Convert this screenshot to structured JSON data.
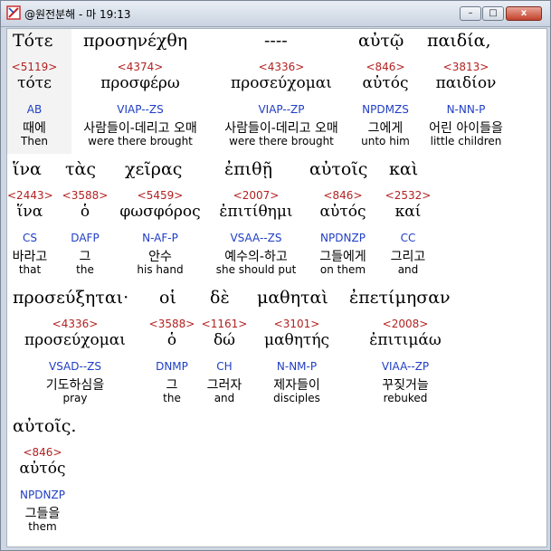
{
  "window": {
    "title": "@원전분해 - 마 19:13",
    "buttons": {
      "minimize": "–",
      "maximize": "□",
      "close": "x"
    }
  },
  "rows": [
    {
      "words": [
        {
          "greek": "Τότε",
          "strong": "<5119>",
          "lemma": "τότε",
          "parse": "AB",
          "kor": "때에",
          "eng": "Then"
        },
        {
          "greek": "προσηνέχθη",
          "strong": "<4374>",
          "lemma": "προσφέρω",
          "parse": "VIAP--ZS",
          "kor": "사람들이-데리고 오매",
          "eng": "were there brought"
        },
        {
          "greek": "----",
          "strong": "<4336>",
          "lemma": "προσεύχομαι",
          "parse": "VIAP--ZP",
          "kor": "사람들이-데리고 오매",
          "eng": "were there brought"
        },
        {
          "greek": "αὐτῷ",
          "strong": "<846>",
          "lemma": "αὐτός",
          "parse": "NPDMZS",
          "kor": "그에게",
          "eng": "unto him"
        },
        {
          "greek": "παιδία,",
          "strong": "<3813>",
          "lemma": "παιδίον",
          "parse": "N-NN-P",
          "kor": "어린 아이들을",
          "eng": "little children"
        }
      ]
    },
    {
      "words": [
        {
          "greek": "ἵνα",
          "strong": "<2443>",
          "lemma": "ἵνα",
          "parse": "CS",
          "kor": "바라고",
          "eng": "that"
        },
        {
          "greek": "τὰς",
          "strong": "<3588>",
          "lemma": "ὁ",
          "parse": "DAFP",
          "kor": "그",
          "eng": "the"
        },
        {
          "greek": "χεῖρας",
          "strong": "<5459>",
          "lemma": "φωσφόρος",
          "parse": "N-AF-P",
          "kor": "안수",
          "eng": "his hand"
        },
        {
          "greek": "ἐπιθῇ",
          "strong": "<2007>",
          "lemma": "ἐπιτίθημι",
          "parse": "VSAA--ZS",
          "kor": "예수의-하고",
          "eng": "she should put"
        },
        {
          "greek": "αὐτοῖς",
          "strong": "<846>",
          "lemma": "αὐτός",
          "parse": "NPDNZP",
          "kor": "그들에게",
          "eng": "on them"
        },
        {
          "greek": "καὶ",
          "strong": "<2532>",
          "lemma": "καί",
          "parse": "CC",
          "kor": "그리고",
          "eng": "and"
        }
      ]
    },
    {
      "words": [
        {
          "greek": "προσεύξηται·",
          "strong": "<4336>",
          "lemma": "προσεύχομαι",
          "parse": "VSAD--ZS",
          "kor": "기도하심을",
          "eng": "pray"
        },
        {
          "greek": "οἱ",
          "strong": "<3588>",
          "lemma": "ὁ",
          "parse": "DNMP",
          "kor": "그",
          "eng": "the"
        },
        {
          "greek": "δὲ",
          "strong": "<1161>",
          "lemma": "δώ",
          "parse": "CH",
          "kor": "그러자",
          "eng": "and"
        },
        {
          "greek": "μαθηταὶ",
          "strong": "<3101>",
          "lemma": "μαθητής",
          "parse": "N-NM-P",
          "kor": "제자들이",
          "eng": "disciples"
        },
        {
          "greek": "ἐπετίμησαν",
          "strong": "<2008>",
          "lemma": "ἐπιτιμάω",
          "parse": "VIAA--ZP",
          "kor": "꾸짖거늘",
          "eng": "rebuked"
        }
      ]
    },
    {
      "words": [
        {
          "greek": "αὐτοῖς.",
          "strong": "<846>",
          "lemma": "αὐτός",
          "parse": "NPDNZP",
          "kor": "그들을",
          "eng": "them"
        }
      ]
    }
  ]
}
